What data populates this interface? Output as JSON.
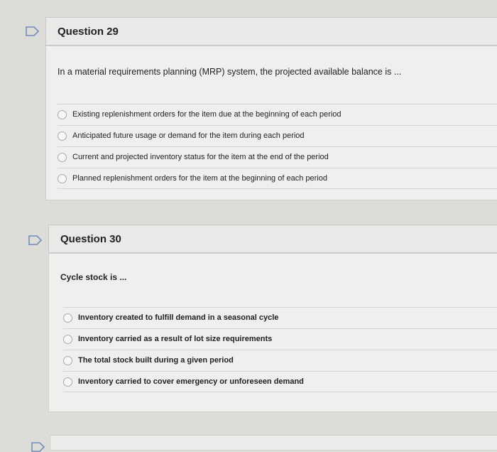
{
  "questions": [
    {
      "title": "Question 29",
      "prompt": "In a material requirements planning (MRP) system, the projected available balance is ...",
      "options": [
        "Existing replenishment orders for the item due at the beginning of each period",
        "Anticipated future usage or demand for the item during each period",
        "Current and projected inventory status for the item at the end of the period",
        "Planned replenishment orders for the item at the beginning of each period"
      ]
    },
    {
      "title": "Question 30",
      "prompt": "Cycle stock is ...",
      "options": [
        "Inventory created to fulfill demand in a seasonal cycle",
        "Inventory carried as a result of lot size requirements",
        "The total stock built during a given period",
        "Inventory carried to cover emergency or unforeseen demand"
      ]
    }
  ],
  "colors": {
    "flag": "#6f8fb8",
    "background": "#dcdcd8"
  },
  "icons": {
    "flag": "flag-icon",
    "radio": "radio-button"
  }
}
